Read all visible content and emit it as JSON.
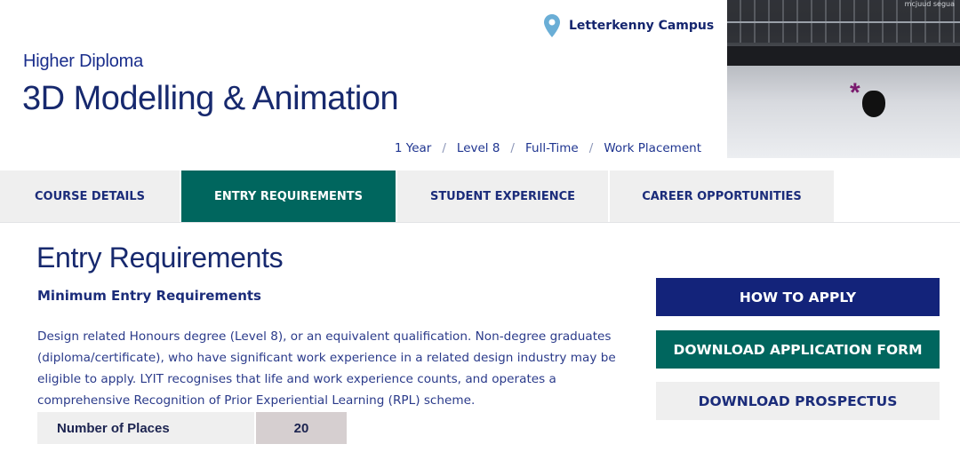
{
  "header": {
    "campus": "Letterkenny Campus",
    "award": "Higher Diploma",
    "title": "3D Modelling & Animation",
    "meta": {
      "duration": "1 Year",
      "level": "Level 8",
      "mode": "Full-Time",
      "placement": "Work Placement",
      "separator": "/"
    },
    "hero_caption": "mcjuud segua"
  },
  "tabs": [
    {
      "label": "COURSE DETAILS",
      "active": false
    },
    {
      "label": "ENTRY REQUIREMENTS",
      "active": true
    },
    {
      "label": "STUDENT EXPERIENCE",
      "active": false
    },
    {
      "label": "CAREER OPPORTUNITIES",
      "active": false
    }
  ],
  "main": {
    "heading": "Entry Requirements",
    "subheading": "Minimum Entry Requirements",
    "body": "Design related Honours degree (Level 8), or an equivalent qualification. Non-degree graduates (diploma/certificate), who have significant work experience in a related design industry may be eligible to apply. LYIT recognises that life and work experience counts, and operates a comprehensive Recognition of Prior Experiential Learning (RPL) scheme.",
    "places": {
      "label": "Number of Places",
      "value": "20"
    }
  },
  "actions": {
    "apply": "HOW TO APPLY",
    "application_form": "DOWNLOAD APPLICATION FORM",
    "prospectus": "DOWNLOAD PROSPECTUS"
  },
  "colors": {
    "navy": "#13237a",
    "teal": "#00665e",
    "light_gray": "#efefef",
    "pin": "#6aaed6"
  }
}
